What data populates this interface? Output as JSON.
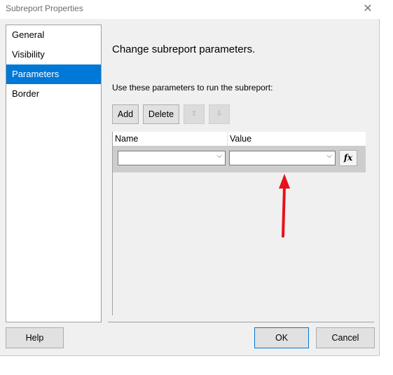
{
  "window": {
    "title": "Subreport Properties",
    "close_glyph": "✕"
  },
  "nav": {
    "items": [
      {
        "label": "General",
        "selected": false
      },
      {
        "label": "Visibility",
        "selected": false
      },
      {
        "label": "Parameters",
        "selected": true
      },
      {
        "label": "Border",
        "selected": false
      }
    ]
  },
  "main": {
    "heading": "Change subreport parameters.",
    "instruction": "Use these parameters to run the subreport:",
    "toolbar": {
      "add_label": "Add",
      "delete_label": "Delete",
      "move_up_glyph": "⇧",
      "move_down_glyph": "⇩"
    },
    "grid": {
      "columns": [
        "Name",
        "Value"
      ],
      "rows": [
        {
          "name": "",
          "value": ""
        }
      ],
      "dropdown_glyph": "⌵",
      "fx_label": "fx"
    }
  },
  "footer": {
    "help_label": "Help",
    "ok_label": "OK",
    "cancel_label": "Cancel"
  },
  "colors": {
    "selection": "#0078d7",
    "annotation_arrow": "#e8111b"
  },
  "icons": [
    "close-icon",
    "move-up-icon",
    "move-down-icon",
    "dropdown-arrow-icon",
    "expression-icon"
  ]
}
